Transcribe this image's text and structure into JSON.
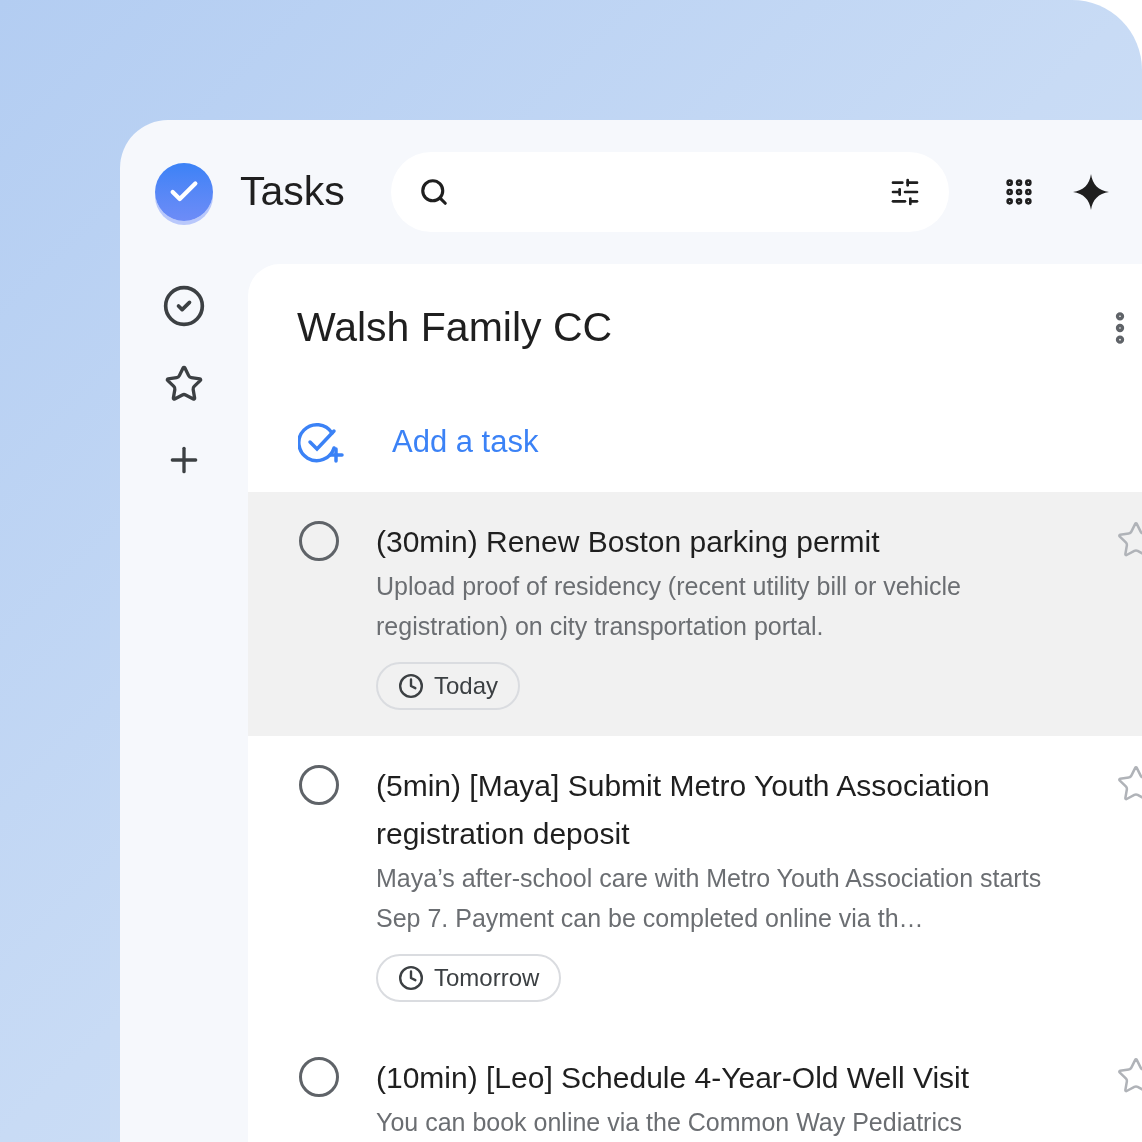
{
  "app": {
    "title": "Tasks"
  },
  "list": {
    "title": "Walsh Family CC",
    "add_label": "Add a task"
  },
  "rail": [
    {
      "kind": "check"
    },
    {
      "kind": "star"
    },
    {
      "kind": "add"
    }
  ],
  "tasks": [
    {
      "title": "(30min) Renew Boston parking permit",
      "description": "Upload proof of residency (recent utility bill or vehicle registration) on city transportation portal.",
      "due": "Today",
      "selected": true,
      "checked": false,
      "starred": false
    },
    {
      "title": "(5min) [Maya] Submit Metro Youth Association registration deposit",
      "description": "Maya’s after-school care with Metro Youth Association starts Sep 7. Payment can be completed online via th…",
      "due": "Tomorrow",
      "selected": false,
      "checked": false,
      "starred": false
    },
    {
      "title": "(10min) [Leo] Schedule 4-Year-Old Well Visit",
      "description": "You can book online via the Common Way Pediatrics",
      "selected": false,
      "checked": false,
      "starred": false
    }
  ]
}
